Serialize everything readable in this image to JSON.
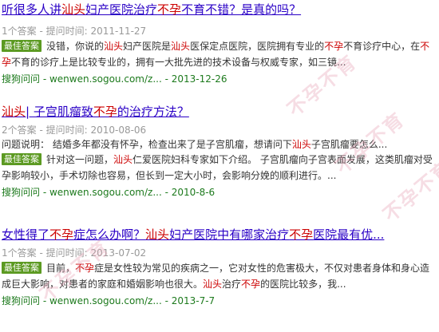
{
  "results": [
    {
      "title_parts": [
        "听很多人讲",
        "汕头",
        "妇产医院治疗",
        "不孕",
        "不育不错？是真的吗？"
      ],
      "meta": "1个答案 - 提问时间: 2011-11-27",
      "badge": "最佳答案",
      "answer_parts": [
        "没错，你说的",
        "汕头",
        "妇产医院是",
        "汕头",
        "医保定点医院，医院拥有专业的",
        "不孕",
        "不育诊疗中心，在",
        "不孕",
        "不育的诊疗上是比较专业的，拥有一大批先进的技术设备与权威专家，如三镜..."
      ],
      "source": "搜狗问问 - wenwen.sogou.com/z... - 2013-12-26"
    },
    {
      "title_parts": [
        "汕头",
        "| 子宫肌瘤致",
        "不孕",
        "的治疗方法？"
      ],
      "meta": "2个答案 - 提问时间: 2010-08-06",
      "question_parts": [
        "问题说明： 结婚多年都没有怀孕，检查出来了是子宫肌瘤，想请问下",
        "汕头",
        "子宫肌瘤要怎么..."
      ],
      "badge": "最佳答案",
      "answer_parts": [
        "针对这一问题，",
        "汕头",
        "仁爱医院妇科专家如下介绍。 子宫肌瘤向子宫表面发展，这类肌瘤对受孕影响较小，手术切除也容易，但长到一定大小时，会影响分娩的顺利进行。..."
      ],
      "source": "搜狗问问 - wenwen.sogou.com/z... - 2010-8-6"
    },
    {
      "title_parts": [
        "女性得了",
        "不孕",
        "症怎么办啊？",
        "汕头",
        "妇产医院中有哪家治疗",
        "不孕",
        "医院最有优..."
      ],
      "meta": "1个答案 - 提问时间: 2013-07-02",
      "badge": "最佳答案",
      "answer_parts": [
        "目前，",
        "不孕",
        "症是女性较为常见的疾病之一，它对女性的危害极大，不仅对患者身体和身心造成巨大影响，对患者的家庭和婚姻影响也很大。",
        "汕头",
        "治疗",
        "不孕",
        "的医院比较多，我..."
      ],
      "source": "搜狗问问 - wenwen.sogou.com/z... - 2013-7-7"
    }
  ],
  "watermark": "不孕不育"
}
